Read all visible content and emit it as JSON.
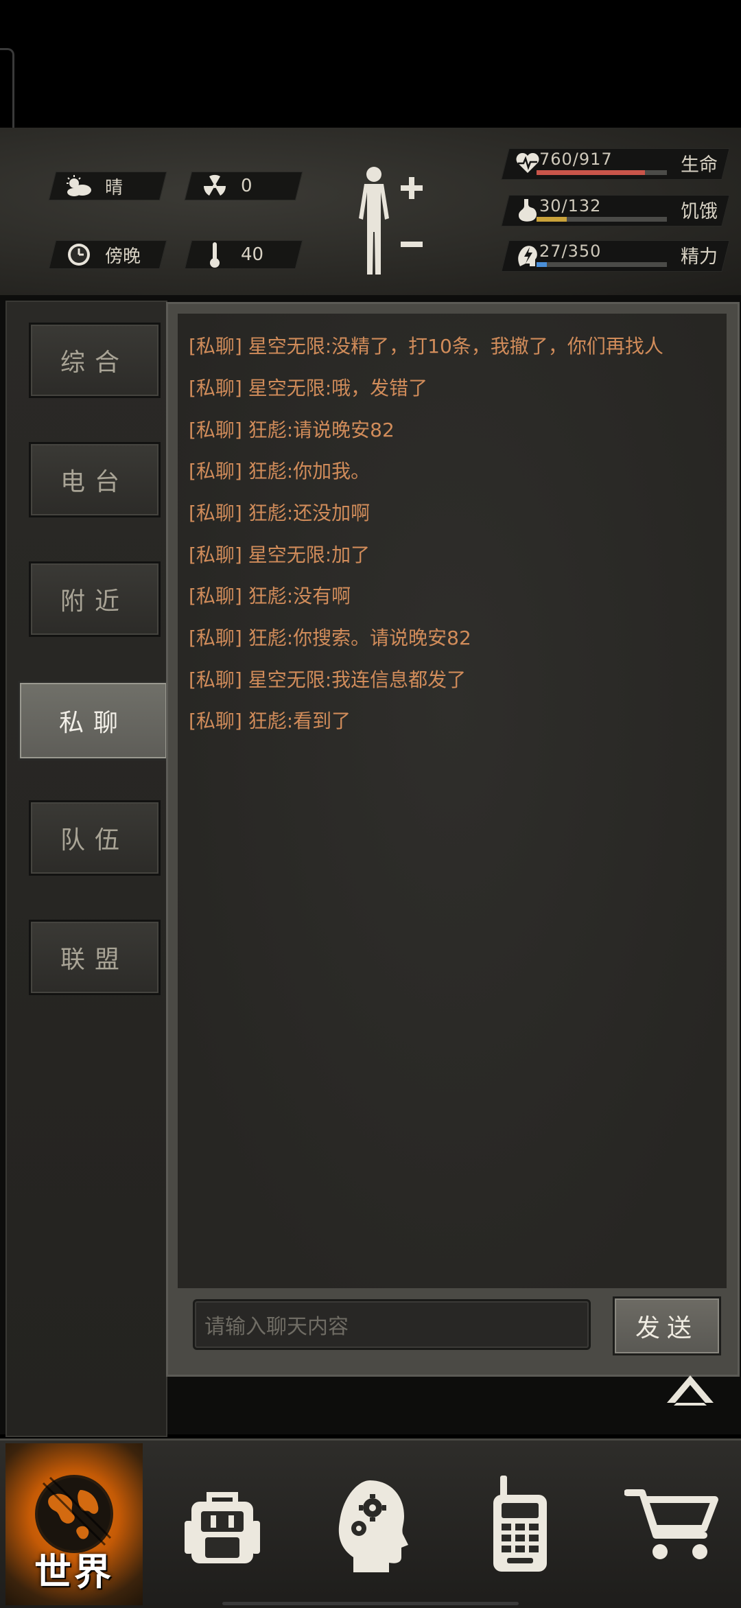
{
  "hud": {
    "weather": "晴",
    "radiation": "0",
    "time_of_day": "傍晚",
    "temperature": "40",
    "stats": [
      {
        "key": "health",
        "value": "760/917",
        "label": "生命",
        "fill": 0.83,
        "color": "#c9554a",
        "icon": "heart-icon"
      },
      {
        "key": "hunger",
        "value": "30/132",
        "label": "饥饿",
        "fill": 0.23,
        "color": "#c9a23a",
        "icon": "stomach-icon"
      },
      {
        "key": "energy",
        "value": "27/350",
        "label": "精力",
        "fill": 0.08,
        "color": "#4a8fd8",
        "icon": "brain-energy-icon"
      }
    ]
  },
  "tabs": [
    {
      "label": "综合"
    },
    {
      "label": "电台"
    },
    {
      "label": "附近"
    },
    {
      "label": "私聊",
      "active": true
    },
    {
      "label": "队伍"
    },
    {
      "label": "联盟"
    }
  ],
  "messages": [
    "[私聊] 星空无限:没精了，打10条，我撤了，你们再找人",
    "[私聊] 星空无限:哦，发错了",
    "[私聊] 狂彪:请说晚安82",
    "[私聊] 狂彪:你加我。",
    "[私聊] 狂彪:还没加啊",
    "[私聊] 星空无限:加了",
    "[私聊] 狂彪:没有啊",
    "[私聊] 狂彪:你搜索。请说晚安82",
    "[私聊] 星空无限:我连信息都发了",
    "[私聊] 狂彪:看到了"
  ],
  "input": {
    "placeholder": "请输入聊天内容"
  },
  "send_label": "发送",
  "nav": {
    "world_label": "世界",
    "items": [
      "globe-icon",
      "backpack-icon",
      "head-gears-icon",
      "walkie-talkie-icon",
      "cart-icon"
    ]
  }
}
